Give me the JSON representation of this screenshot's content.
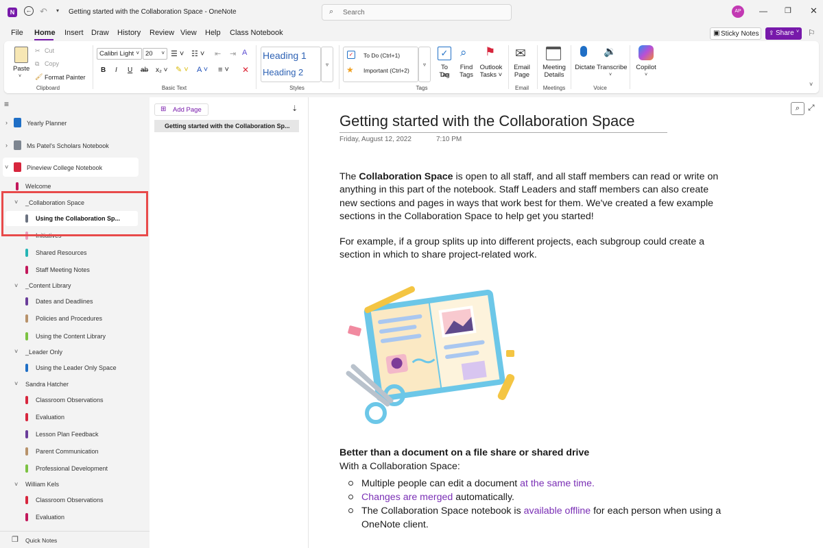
{
  "titlebar": {
    "title": "Getting started with the Collaboration Space  -  OneNote",
    "search_placeholder": "Search",
    "avatar_initials": "AP"
  },
  "menu": [
    "File",
    "Home",
    "Insert",
    "Draw",
    "History",
    "Review",
    "View",
    "Help",
    "Class Notebook"
  ],
  "menu_active": "Home",
  "right_buttons": {
    "sticky_notes": "Sticky Notes",
    "share": "Share"
  },
  "ribbon": {
    "clipboard": {
      "paste": "Paste",
      "cut": "Cut",
      "copy": "Copy",
      "format_painter": "Format Painter",
      "label": "Clipboard"
    },
    "basic_text": {
      "font": "Calibri Light",
      "size": "20",
      "label": "Basic Text"
    },
    "styles": {
      "heading1": "Heading 1",
      "heading2": "Heading 2",
      "label": "Styles"
    },
    "tags": {
      "todo": "To Do (Ctrl+1)",
      "important": "Important (Ctrl+2)",
      "todo_tag": [
        "To Do",
        "Tag"
      ],
      "find_tags": [
        "Find",
        "Tags"
      ],
      "outlook_tasks": [
        "Outlook",
        "Tasks ˅"
      ],
      "label": "Tags"
    },
    "email": {
      "lines": [
        "Email",
        "Page"
      ],
      "label": "Email"
    },
    "meetings": {
      "lines": [
        "Meeting",
        "Details"
      ],
      "label": "Meetings"
    },
    "voice": {
      "dictate": "Dictate",
      "transcribe": "Transcribe",
      "label": "Voice"
    },
    "copilot": "Copilot"
  },
  "notebooks": [
    {
      "name": "Yearly Planner",
      "color": "#1f6fc6"
    },
    {
      "name": "Ms Patel's Scholars Notebook",
      "color": "#7d8590"
    },
    {
      "name": "Pineview College Notebook",
      "color": "#d7263d"
    }
  ],
  "sections": {
    "welcome": "Welcome",
    "collab_group": "_Collaboration Space",
    "collab_selected": "Using the Collaboration Sp...",
    "initiatives": "Initiatives",
    "shared_resources": "Shared Resources",
    "staff_meeting": "Staff Meeting Notes",
    "content_group": "_Content Library",
    "dates": "Dates and Deadlines",
    "policies": "Policies and Procedures",
    "using_content": "Using the Content Library",
    "leader_group": "_Leader Only",
    "using_leader": "Using the Leader Only Space",
    "sandra_group": "Sandra Hatcher",
    "classroom_obs": "Classroom Observations",
    "evaluation": "Evaluation",
    "lesson_plan": "Lesson Plan Feedback",
    "parent_comm": "Parent Communication",
    "prof_dev": "Professional Development",
    "william_group": "William Kels",
    "classroom_obs2": "Classroom Observations",
    "evaluation2": "Evaluation",
    "quick_notes": "Quick Notes"
  },
  "colors": {
    "welcome": "#c2185b",
    "collab": "#6b7280",
    "initiatives": "#e8a0c0",
    "shared": "#26b5b5",
    "staff": "#c2185b",
    "dates": "#6a3d9a",
    "policies": "#b8926a",
    "using_content": "#7cc242",
    "using_leader": "#1f6fc6",
    "classroom": "#d7263d",
    "evaluation": "#d7263d",
    "lesson": "#6a3d9a",
    "parent": "#b8926a",
    "prof": "#7cc242",
    "classroom2": "#d7263d",
    "eval2": "#c2185b",
    "accent": "#7a2fb5",
    "highlight_box": "#e84a4a"
  },
  "pagelist": {
    "add_page": "Add Page",
    "page_title": "Getting started with the Collaboration Sp..."
  },
  "page": {
    "title": "Getting started with the Collaboration Space",
    "date": "Friday, August 12, 2022",
    "time": "7:10 PM",
    "p1": [
      {
        "pre": "The ",
        "bold": "Collaboration Space",
        "post": " is open to all staff, and all staff members can read or write on"
      },
      "anything in this part of the notebook. Staff Leaders and staff members can also create",
      "new sections and pages in ways that work best for them. We've created a few example",
      "sections in the Collaboration Space to help get you started!"
    ],
    "p2": [
      "For example, if a group splits up into different projects, each subgroup could create a",
      "section in which to share project-related work."
    ],
    "heading": "Better than a document on a file share or shared drive",
    "sub": "With a Collaboration Space:",
    "bullets": [
      {
        "pre": "Multiple people can edit a document ",
        "link": "at the same time.",
        "post": ""
      },
      {
        "pre": "",
        "link": "Changes are merged",
        "post": " automatically."
      },
      {
        "pre": "The Collaboration Space notebook is ",
        "link": "available offline",
        "post": " for each person when using a"
      },
      {
        "pre": "OneNote client.",
        "link": "",
        "post": ""
      }
    ]
  }
}
